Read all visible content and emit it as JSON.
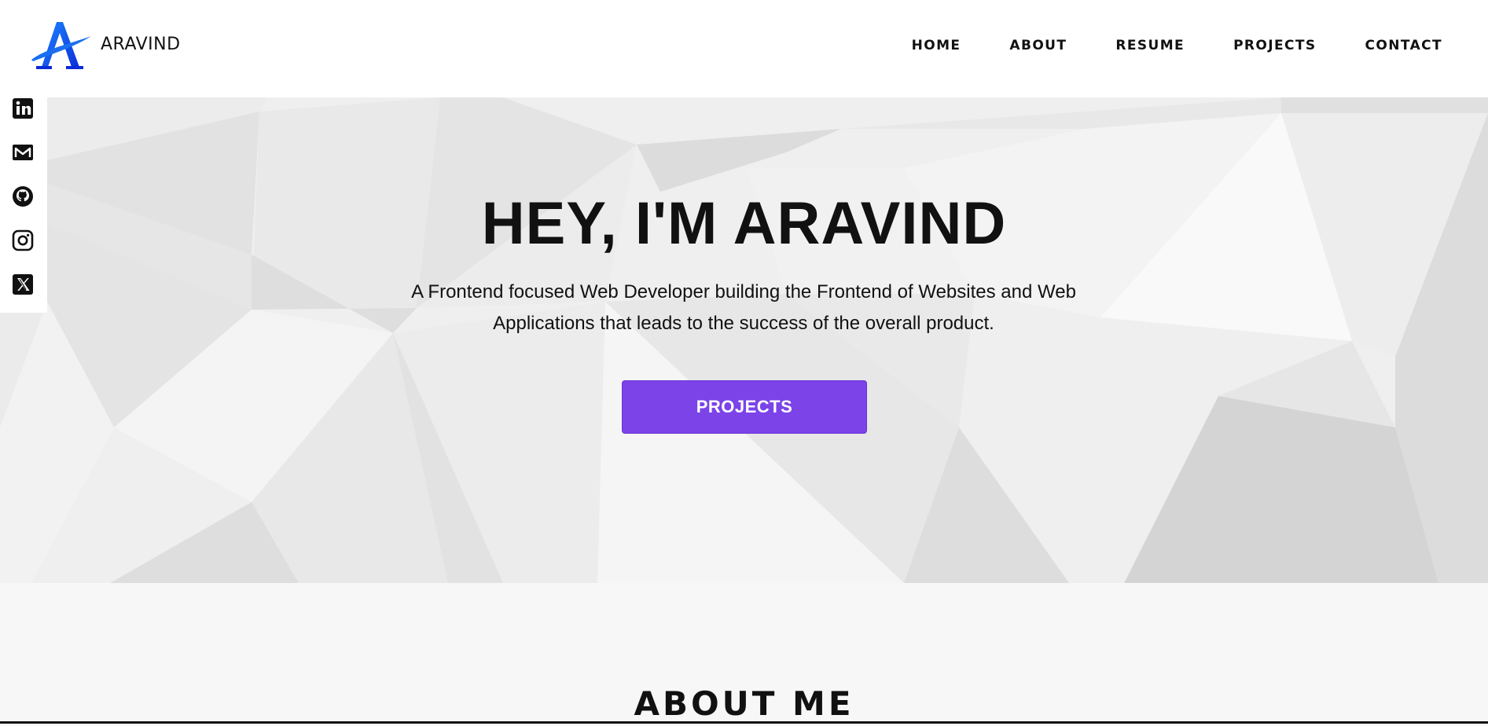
{
  "header": {
    "brand": "ARAVIND",
    "logo_icon": "aravind-logo-a",
    "nav": [
      {
        "label": "HOME"
      },
      {
        "label": "ABOUT"
      },
      {
        "label": "RESUME"
      },
      {
        "label": "PROJECTS"
      },
      {
        "label": "CONTACT"
      }
    ]
  },
  "social": [
    {
      "icon": "linkedin-icon"
    },
    {
      "icon": "gmail-icon"
    },
    {
      "icon": "github-icon"
    },
    {
      "icon": "instagram-icon"
    },
    {
      "icon": "x-twitter-icon"
    }
  ],
  "hero": {
    "title": "HEY, I'M ARAVIND",
    "subtitle": "A Frontend focused Web Developer building the Frontend of Websites and Web Applications that leads to the success of the overall product.",
    "cta_label": "PROJECTS",
    "scroll_icon": "mouse-scroll-icon"
  },
  "about": {
    "title": "ABOUT ME"
  },
  "colors": {
    "accent": "#7b43e8",
    "text": "#111111",
    "header_bg": "#ffffff",
    "page_bg": "#f7f7f7"
  }
}
